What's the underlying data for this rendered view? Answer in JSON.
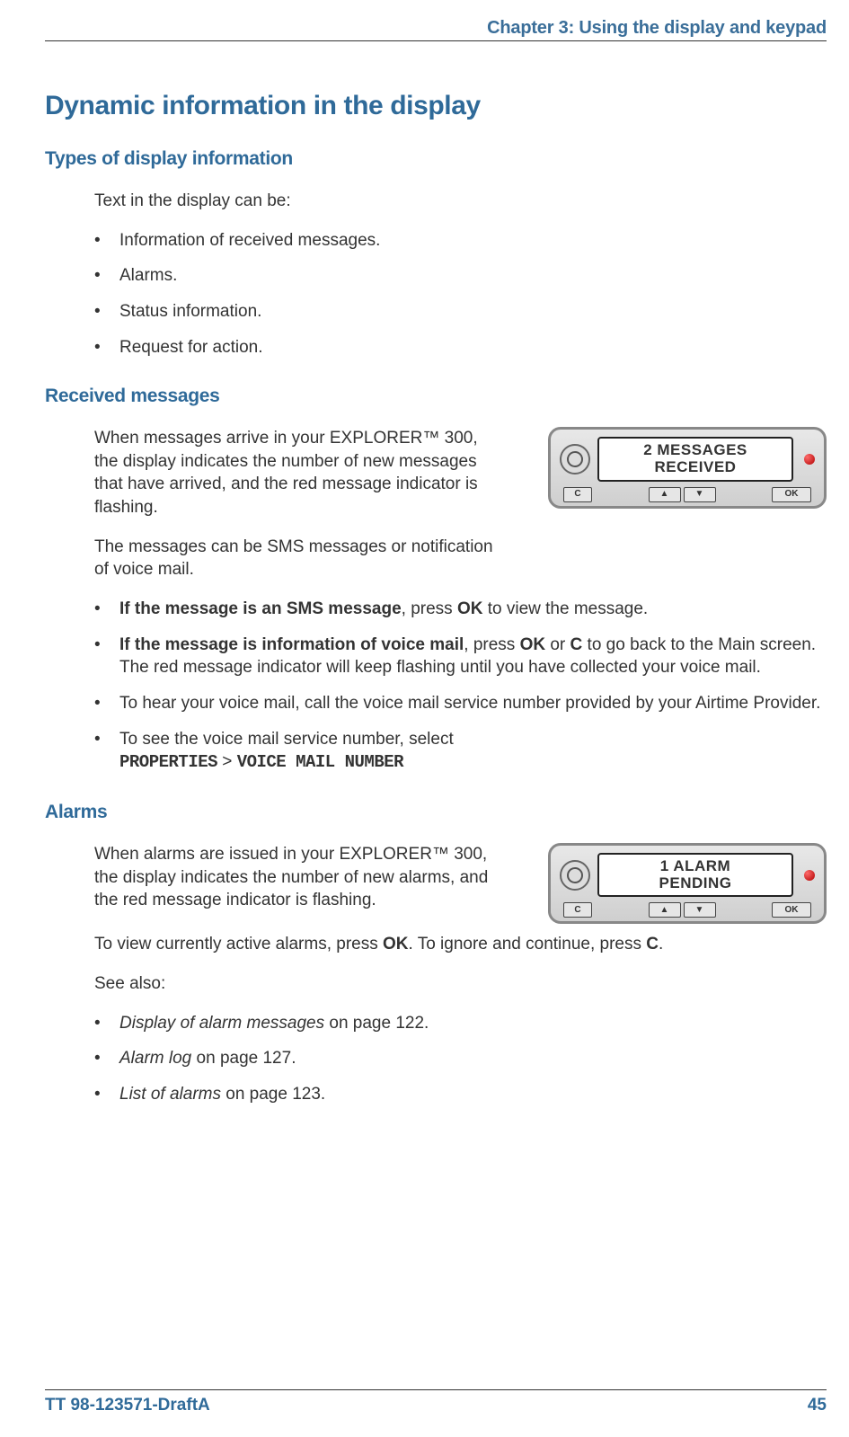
{
  "header": {
    "chapter": "Chapter 3: Using the display and keypad"
  },
  "h1": "Dynamic information in the display",
  "types": {
    "heading": "Types of display information",
    "intro": "Text in the display can be:",
    "items": [
      "Information of received messages.",
      "Alarms.",
      "Status information.",
      "Request for action."
    ]
  },
  "received": {
    "heading": "Received messages",
    "para1": "When messages arrive in your EXPLORER™ 300, the display indicates the number of new messages that have arrived, and the red message indicator is flashing.",
    "para2": "The messages can be SMS messages or notification of voice mail.",
    "b1_bold": "If the message is an SMS message",
    "b1_rest1": ", press ",
    "b1_ok": "OK",
    "b1_rest2": " to view the message.",
    "b2_bold": "If the message is information of voice mail",
    "b2_rest1": ", press ",
    "b2_ok": "OK",
    "b2_or": " or ",
    "b2_c": "C",
    "b2_rest2": " to go back to the Main screen. The red message indicator will keep flashing until you have collected your voice mail.",
    "b3": "To hear your voice mail, call the voice mail service number provided by your Airtime Provider.",
    "b4_lead": "To see the voice mail service number, select",
    "b4_path1": "PROPERTIES",
    "b4_gt": " > ",
    "b4_path2": "VOICE MAIL NUMBER",
    "device_line1": "2 MESSAGES",
    "device_line2": "RECEIVED"
  },
  "alarms": {
    "heading": "Alarms",
    "para1": "When alarms are issued in your EXPLORER™ 300, the display indicates the number of new alarms, and the red message indicator is flashing.",
    "para2a": "To view currently active alarms, press ",
    "para2_ok": "OK",
    "para2b": ". To ignore and continue, press ",
    "para2_c": "C",
    "para2c": ".",
    "seealso": "See also:",
    "ref1_i": "Display of alarm messages",
    "ref1_r": " on page 122.",
    "ref2_i": "Alarm log",
    "ref2_r": " on page 127.",
    "ref3_i": "List of alarms",
    "ref3_r": " on page 123.",
    "device_line1": "1 ALARM",
    "device_line2": "PENDING"
  },
  "footer": {
    "left": "TT 98-123571-DraftA",
    "right": "45"
  },
  "keys": {
    "c": "C",
    "up": "▲",
    "down": "▼",
    "ok": "OK"
  }
}
